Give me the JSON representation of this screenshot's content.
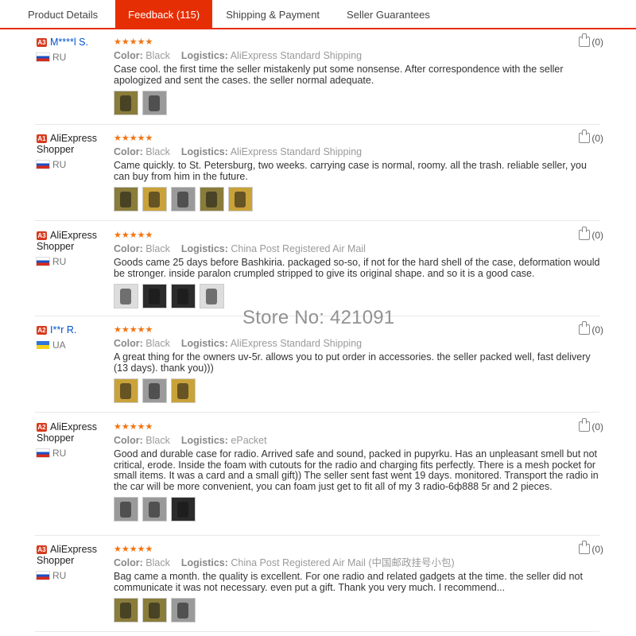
{
  "tabs": [
    {
      "label": "Product Details"
    },
    {
      "label": "Feedback (115)"
    },
    {
      "label": "Shipping & Payment"
    },
    {
      "label": "Seller Guarantees"
    }
  ],
  "watermark": "Store No: 421091",
  "reviews": [
    {
      "level": "A3",
      "name": "M****l S.",
      "country": "RU",
      "stars": "★★★★★",
      "color_label": "Color:",
      "color": "Black",
      "logistics_label": "Logistics:",
      "logistics": "AliExpress Standard Shipping",
      "text": "Case cool. the first time the seller mistakenly put some nonsense. After correspondence with the seller apologized and sent the cases. the seller normal adequate.",
      "likes": "(0)"
    },
    {
      "level": "A1",
      "name": "AliExpress Shopper",
      "country": "RU",
      "stars": "★★★★★",
      "color_label": "Color:",
      "color": "Black",
      "logistics_label": "Logistics:",
      "logistics": "AliExpress Standard Shipping",
      "text": "Came quickly. to St. Petersburg, two weeks. carrying case is normal, roomy. all the trash. reliable seller, you can buy from him in the future.",
      "likes": "(0)"
    },
    {
      "level": "A3",
      "name": "AliExpress Shopper",
      "country": "RU",
      "stars": "★★★★★",
      "color_label": "Color:",
      "color": "Black",
      "logistics_label": "Logistics:",
      "logistics": "China Post Registered Air Mail",
      "text": "Goods came 25 days before Bashkiria. packaged so-so, if not for the hard shell of the case, deformation would be stronger. inside paralon crumpled stripped to give its original shape. and so it is a good case.",
      "likes": "(0)"
    },
    {
      "level": "A2",
      "name": "I**r R.",
      "country": "UA",
      "stars": "★★★★★",
      "color_label": "Color:",
      "color": "Black",
      "logistics_label": "Logistics:",
      "logistics": "AliExpress Standard Shipping",
      "text": "A great thing for the owners uv-5r. allows you to put order in accessories. the seller packed well, fast delivery (13 days). thank you)))",
      "likes": "(0)"
    },
    {
      "level": "A2",
      "name": "AliExpress Shopper",
      "country": "RU",
      "stars": "★★★★★",
      "color_label": "Color:",
      "color": "Black",
      "logistics_label": "Logistics:",
      "logistics": "ePacket",
      "text": "Good and durable case for radio. Arrived safe and sound, packed in pupyrku. Has an unpleasant smell but not critical, erode. Inside the foam with cutouts for the radio and charging fits perfectly. There is a mesh pocket for small items. It was a card and a small gift)) The seller sent fast went 19 days. monitored. Transport the radio in the car will be more convenient, you can foam just get to fit all of my 3 radio-6ф888 5r and 2 pieces.",
      "likes": "(0)"
    },
    {
      "level": "A3",
      "name": "AliExpress Shopper",
      "country": "RU",
      "stars": "★★★★★",
      "color_label": "Color:",
      "color": "Black",
      "logistics_label": "Logistics:",
      "logistics": "China Post Registered Air Mail (中国邮政挂号小包)",
      "text": "Bag came a month. the quality is excellent. For one radio and related gadgets at the time. the seller did not communicate it was not necessary. even put a gift. Thank you very much. I recommend...",
      "likes": "(0)"
    }
  ]
}
